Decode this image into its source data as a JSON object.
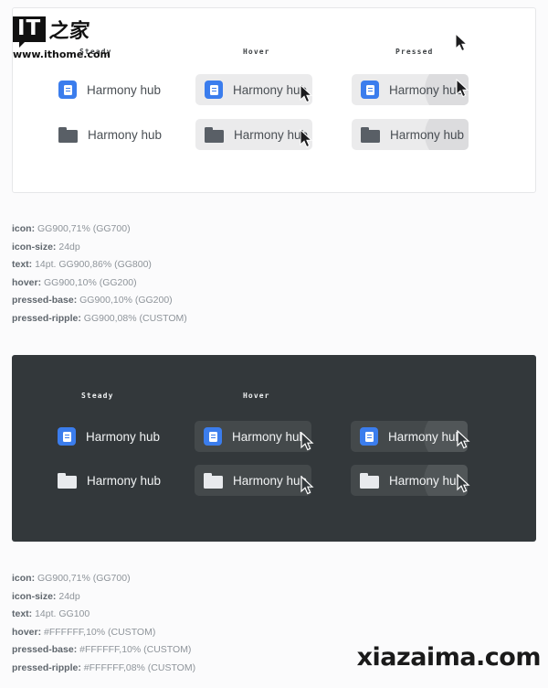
{
  "page": {
    "background": "#fbfbfc"
  },
  "light_panel": {
    "background": "#ffffff",
    "columns": [
      "Steady",
      "Hover",
      "Pressed"
    ],
    "rows": [
      {
        "icon": "app-icon",
        "label": "Harmony hub"
      },
      {
        "icon": "folder-icon",
        "label": "Harmony hub"
      }
    ],
    "accent": "#3b7ded",
    "icon_color": "#595f66",
    "text_color": "#4a4f54",
    "hover_fill": "#ebebec"
  },
  "light_spec": [
    {
      "key": "icon:",
      "value": "GG900,71% (GG700)"
    },
    {
      "key": "icon-size:",
      "value": "24dp"
    },
    {
      "key": "text:",
      "value": "14pt. GG900,86% (GG800)"
    },
    {
      "key": "hover:",
      "value": "GG900,10% (GG200)"
    },
    {
      "key": "pressed-base:",
      "value": "GG900,10% (GG200)"
    },
    {
      "key": "pressed-ripple:",
      "value": "GG900,08%  (CUSTOM)"
    }
  ],
  "dark_panel": {
    "background": "#33383b",
    "columns": [
      "Steady",
      "Hover",
      ""
    ],
    "rows": [
      {
        "icon": "app-icon",
        "label": "Harmony hub"
      },
      {
        "icon": "folder-icon",
        "label": "Harmony hub"
      }
    ],
    "accent": "#3b7ded",
    "icon_color": "#e8eaed",
    "text_color": "#f1f3f4",
    "hover_fill": "#FFFFFF 10%"
  },
  "dark_spec": [
    {
      "key": "icon:",
      "value": "GG900,71% (GG700)"
    },
    {
      "key": "icon-size:",
      "value": "24dp"
    },
    {
      "key": "text:",
      "value": "14pt. GG100"
    },
    {
      "key": "hover:",
      "value": "#FFFFFF,10% (CUSTOM)"
    },
    {
      "key": "pressed-base:",
      "value": "#FFFFFF,10% (CUSTOM)"
    },
    {
      "key": "pressed-ripple:",
      "value": "#FFFFFF,08%  (CUSTOM)"
    }
  ],
  "watermarks": {
    "logo_mark": "IT",
    "logo_cn": "之家",
    "logo_url": "www.ithome.com",
    "bottom": "xiazaima.com"
  }
}
